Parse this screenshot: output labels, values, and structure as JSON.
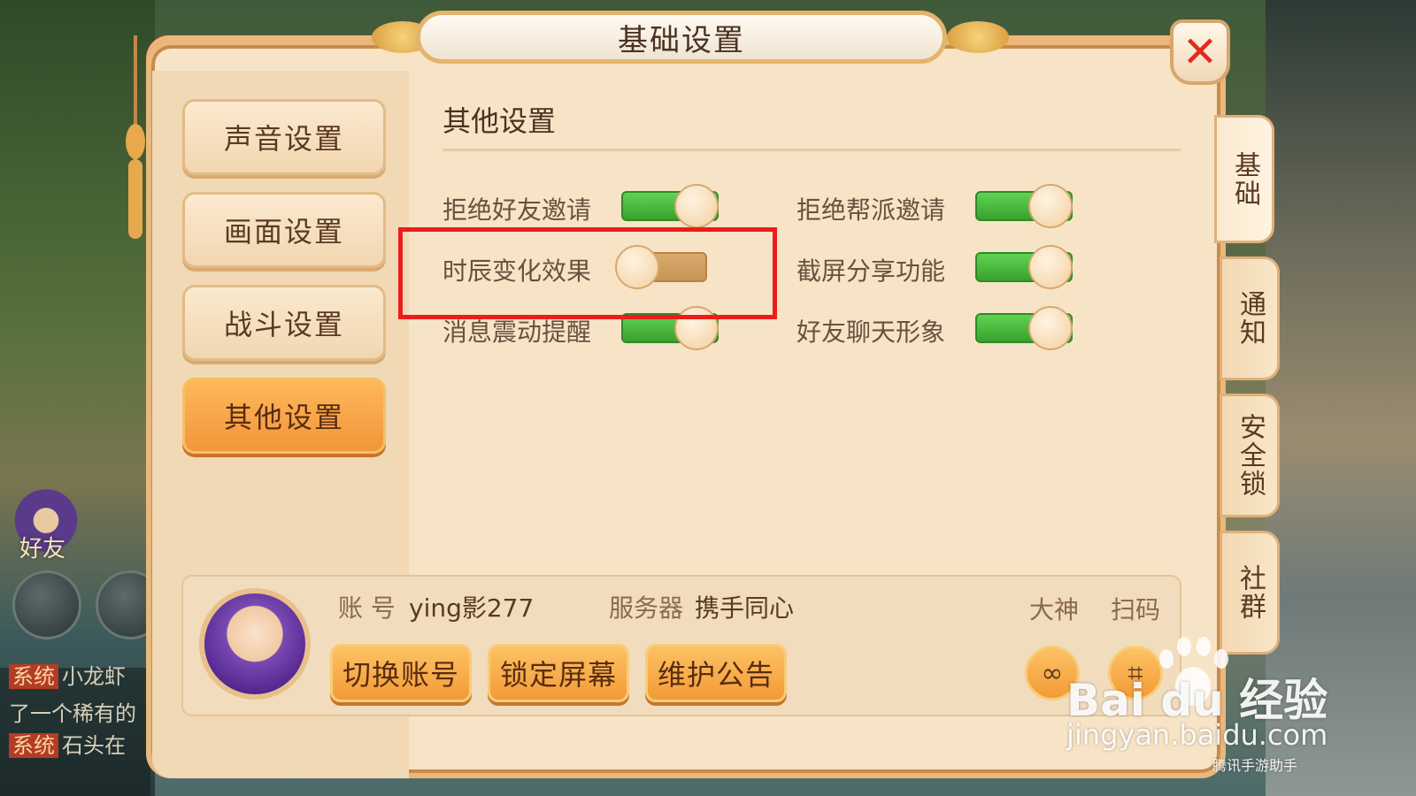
{
  "dialog": {
    "title": "基础设置",
    "close_icon": "close-icon"
  },
  "left_menu": [
    {
      "label": "声音设置",
      "active": false
    },
    {
      "label": "画面设置",
      "active": false
    },
    {
      "label": "战斗设置",
      "active": false
    },
    {
      "label": "其他设置",
      "active": true
    }
  ],
  "section": {
    "title": "其他设置",
    "options": [
      {
        "label": "拒绝好友邀请",
        "on": true
      },
      {
        "label": "拒绝帮派邀请",
        "on": true
      },
      {
        "label": "时辰变化效果",
        "on": false
      },
      {
        "label": "截屏分享功能",
        "on": true
      },
      {
        "label": "消息震动提醒",
        "on": true
      },
      {
        "label": "好友聊天形象",
        "on": true
      }
    ]
  },
  "right_tabs": [
    {
      "label": "基础",
      "active": true
    },
    {
      "label": "通知",
      "active": false
    },
    {
      "label": "安全锁",
      "active": false
    },
    {
      "label": "社群",
      "active": false
    }
  ],
  "account": {
    "account_label": "账 号",
    "account_value": "ying影277",
    "server_label": "服务器",
    "server_value": "携手同心",
    "link_dashen": "大神",
    "link_scan": "扫码",
    "buttons": [
      "切换账号",
      "锁定屏幕",
      "维护公告"
    ]
  },
  "background": {
    "friend_label": "好友",
    "chat": [
      {
        "tag": "系统",
        "text": "小龙虾"
      },
      {
        "tag": "",
        "text": "了一个稀有的"
      },
      {
        "tag": "系统",
        "text": "石头在"
      }
    ]
  },
  "watermark": {
    "brand": "Bai du 经验",
    "url": "jingyan.baidu.com",
    "credit": "腾讯手游助手"
  },
  "colors": {
    "toggle_on": "#4cc23e",
    "toggle_off": "#d3a265",
    "highlight": "#ec1c1c",
    "accent": "#f29b36"
  }
}
